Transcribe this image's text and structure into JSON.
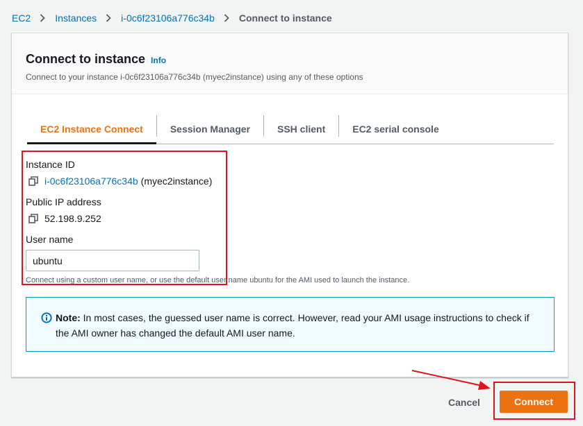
{
  "breadcrumb": {
    "items": [
      "EC2",
      "Instances",
      "i-0c6f23106a776c34b"
    ],
    "current": "Connect to instance"
  },
  "panel": {
    "title": "Connect to instance",
    "info_label": "Info",
    "description": "Connect to your instance i-0c6f23106a776c34b (myec2instance) using any of these options"
  },
  "tabs": [
    {
      "label": "EC2 Instance Connect",
      "active": true
    },
    {
      "label": "Session Manager",
      "active": false
    },
    {
      "label": "SSH client",
      "active": false
    },
    {
      "label": "EC2 serial console",
      "active": false
    }
  ],
  "instance": {
    "id_label": "Instance ID",
    "id_value": "i-0c6f23106a776c34b",
    "id_name": "(myec2instance)",
    "ip_label": "Public IP address",
    "ip_value": "52.198.9.252"
  },
  "username": {
    "label": "User name",
    "value": "ubuntu",
    "hint": "Connect using a custom user name, or use the default user name ubuntu for the AMI used to launch the instance."
  },
  "alert": {
    "note_label": "Note:",
    "text": " In most cases, the guessed user name is correct. However, read your AMI usage instructions to check if the AMI owner has changed the default AMI user name."
  },
  "footer": {
    "cancel_label": "Cancel",
    "connect_label": "Connect"
  },
  "colors": {
    "accent": "#ec7211",
    "link": "#0073bb",
    "annotation": "#e0121a",
    "info_border": "#00a1c9"
  },
  "icons": [
    "chevron-right-icon",
    "copy-icon",
    "info-circle-icon"
  ]
}
